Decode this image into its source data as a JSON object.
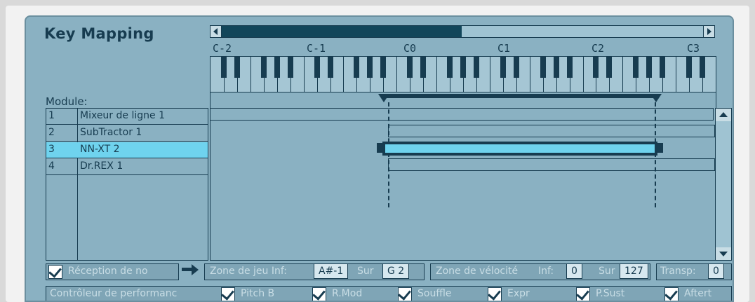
{
  "panel": {
    "title": "Key Mapping",
    "module_label": "Module:"
  },
  "keyboard": {
    "octaves": [
      "C-2",
      "C-1",
      "C0",
      "C1",
      "C2",
      "C3"
    ]
  },
  "modules": [
    {
      "num": "1",
      "name": "Mixeur de ligne 1"
    },
    {
      "num": "2",
      "name": "SubTractor 1"
    },
    {
      "num": "3",
      "name": "NN-XT 2"
    },
    {
      "num": "4",
      "name": "Dr.REX 1"
    }
  ],
  "selected_module": 2,
  "controls": {
    "reception_label": "Réception de no",
    "zone_jeu_label": "Zone de jeu Inf:",
    "zone_jeu_inf": "A#-1",
    "zone_jeu_sup_label": "Sur",
    "zone_jeu_sup": "G 2",
    "zone_velocite_label": "Zone de vélocité",
    "velocite_inf_label": "Inf:",
    "velocite_inf": "0",
    "velocite_sup_label": "Sur",
    "velocite_sup": "127",
    "transp_label": "Transp:",
    "transp_value": "0",
    "perf_label": "Contrôleur de performanc",
    "perf_items": [
      "Pitch B",
      "R.Mod",
      "Souffle",
      "Expr",
      "P.Sust",
      "Aftert"
    ]
  },
  "colors": {
    "lcd_bg": "#8ab1c2",
    "ink": "#173c50",
    "highlight": "#6fd3ee"
  }
}
